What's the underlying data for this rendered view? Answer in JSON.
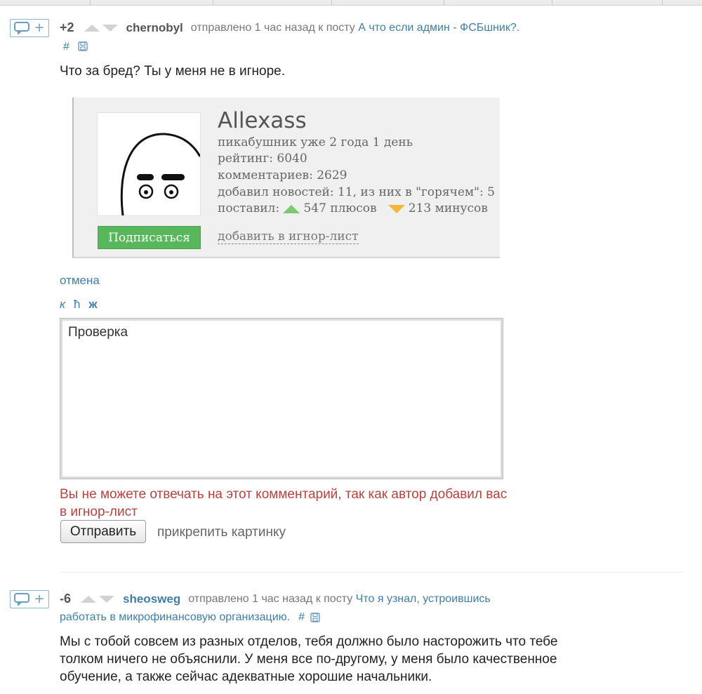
{
  "comment1": {
    "score": "+2",
    "author": "chernobyl",
    "sent_text": "отправлено 1 час назад к посту",
    "post_link": "А что если админ - ФСБшник?.",
    "hash": "#",
    "body": "Что за бред? Ты у меня не в игноре.",
    "profile": {
      "username": "Allexass",
      "age": "пикабушник уже 2 года 1 день",
      "rating": "рейтинг: 6040",
      "comments": "комментариев: 2629",
      "news": "добавил новостей: 11, из них в \"горячем\": 5",
      "gave_label": "поставил:",
      "pluses": "547 плюсов",
      "minuses": "213 минусов",
      "subscribe_label": "Подписаться",
      "ignore_label": "добавить в игнор-лист"
    },
    "cancel_label": "отмена",
    "format_buttons": {
      "italic": "к",
      "strike": "ħ",
      "bold": "ж"
    },
    "reply_value": "Проверка",
    "error": "Вы не можете отвечать на этот комментарий, так как автор добавил вас в игнор-лист",
    "send_label": "Отправить",
    "attach_label": "прикрепить картинку"
  },
  "comment2": {
    "score": "-6",
    "author": "sheosweg",
    "sent_text": "отправлено 1 час назад к посту",
    "post_link_part1": "Что я узнал, устроившись",
    "post_link_part2": "работать в микрофинансовую организацию.",
    "hash": "#",
    "body": "Мы с тобой совсем из разных отделов, тебя должно было насторожить что тебе толком ничего не объяснили. У меня все по-другому, у меня было качественное обучение, а также сейчас адекватные хорошие начальники."
  },
  "colors": {
    "link": "#3f7ea6",
    "error": "#b8423f",
    "subscribe": "#57b75a",
    "plus_arrow": "#7bc96f",
    "minus_arrow": "#f5b63a"
  },
  "icons": [
    "comment-bubble-icon",
    "upvote-icon",
    "downvote-icon",
    "save-icon",
    "avatar-face-icon"
  ]
}
